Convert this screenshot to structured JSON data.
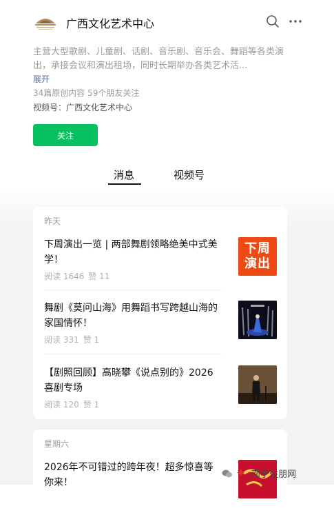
{
  "account": {
    "name": "广西文化艺术中心",
    "description": "主营大型歌剧、儿童剧、话剧、音乐剧、音乐会、舞蹈等各类演出，承接会议和演出租场，同时长期举办各类艺术活...",
    "expand_label": "展开",
    "stats": "34篇原创内容  59个朋友关注",
    "channels": "视频号：广西文化艺术中心",
    "follow_label": "关注"
  },
  "icons": {
    "search": "search-icon",
    "more": "more-icon"
  },
  "tabs": [
    {
      "label": "消息",
      "active": true
    },
    {
      "label": "视频号",
      "active": false
    }
  ],
  "groups": [
    {
      "day": "昨天",
      "articles": [
        {
          "title": "下周演出一览 | 两部舞剧领略绝美中式美学！",
          "reads": "阅读 1646",
          "likes": "赞 11",
          "thumb_text": [
            "下周",
            "演出"
          ]
        },
        {
          "title": "舞剧《莫问山海》用舞蹈书写跨越山海的家国情怀！",
          "reads": "阅读 331",
          "likes": "赞 1"
        },
        {
          "title": "【剧照回顾】高晓攀《说点别的》2026喜剧专场",
          "reads": "阅读 120",
          "likes": "赞 1"
        }
      ]
    },
    {
      "day": "星期六",
      "articles": [
        {
          "title": "2026年不可错过的跨年夜！超多惊喜等你来！"
        }
      ]
    }
  ],
  "watermark": {
    "text": "南宁住朋网"
  },
  "colors": {
    "accent_green": "#07c160",
    "link_blue": "#576b95",
    "thumb_orange": "#f04a14"
  }
}
